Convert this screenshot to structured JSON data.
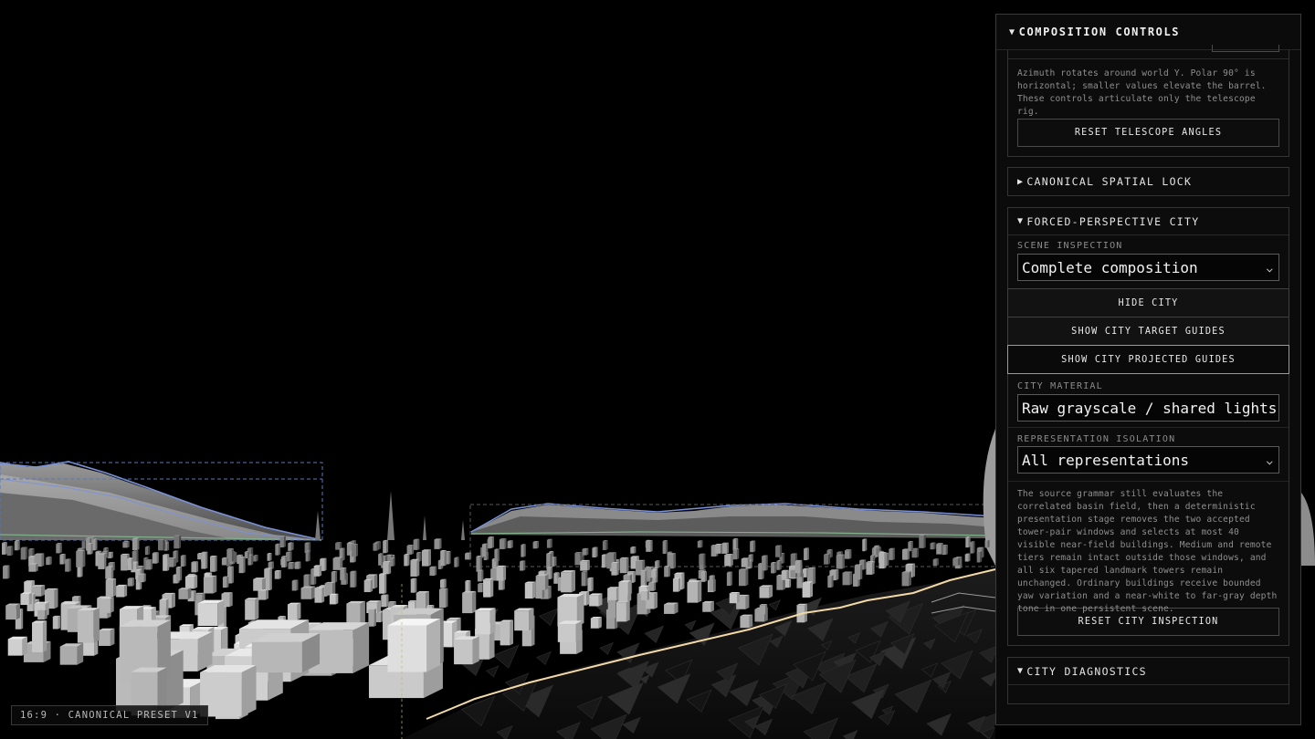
{
  "viewport": {
    "preset_badge": "16:9 · CANONICAL PRESET V1"
  },
  "panel": {
    "title": "COMPOSITION CONTROLS",
    "telescope": {
      "note": "Azimuth rotates around world Y. Polar 90° is horizontal; smaller values elevate the barrel. These controls articulate only the telescope rig.",
      "reset_label": "RESET TELESCOPE ANGLES"
    },
    "spatial_lock": {
      "title": "CANONICAL SPATIAL LOCK",
      "expanded": false
    },
    "city": {
      "title": "FORCED-PERSPECTIVE CITY",
      "expanded": true,
      "scene_inspection_label": "SCENE INSPECTION",
      "scene_inspection_value": "Complete composition",
      "hide_city_label": "HIDE CITY",
      "show_target_guides_label": "SHOW CITY TARGET GUIDES",
      "show_projected_guides_label": "SHOW CITY PROJECTED GUIDES",
      "material_label": "CITY MATERIAL",
      "material_value": "Raw grayscale / shared lights",
      "isolation_label": "REPRESENTATION ISOLATION",
      "isolation_value": "All representations",
      "note": "The source grammar still evaluates the correlated basin field, then a deterministic presentation stage removes the two accepted tower-pair windows and selects at most 40 visible near-field buildings. Medium and remote tiers remain intact outside those windows, and all six tapered landmark towers remain unchanged. Ordinary buildings receive bounded yaw variation and a near-white to far-gray depth tone in one persistent scene.",
      "reset_label": "RESET CITY INSPECTION"
    },
    "diagnostics": {
      "title": "CITY DIAGNOSTICS",
      "expanded": true
    }
  },
  "icons": {
    "expanded": "caret-down-icon",
    "collapsed": "caret-right-icon",
    "select": "chevron-down-icon"
  },
  "colors": {
    "background": "#000000",
    "guide_blue": "#6f86c9",
    "guide_green": "#7fae86",
    "path_highlight": "#f3d9a8"
  }
}
